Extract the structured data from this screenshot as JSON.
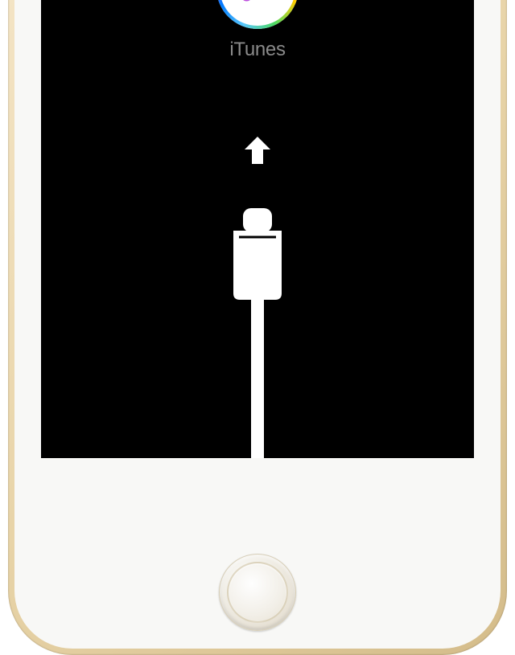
{
  "recovery_screen": {
    "itunes_label": "iTunes",
    "icon_names": {
      "itunes": "itunes-icon",
      "arrow": "arrow-up-icon",
      "cable": "lightning-cable-icon",
      "home": "home-button"
    }
  }
}
